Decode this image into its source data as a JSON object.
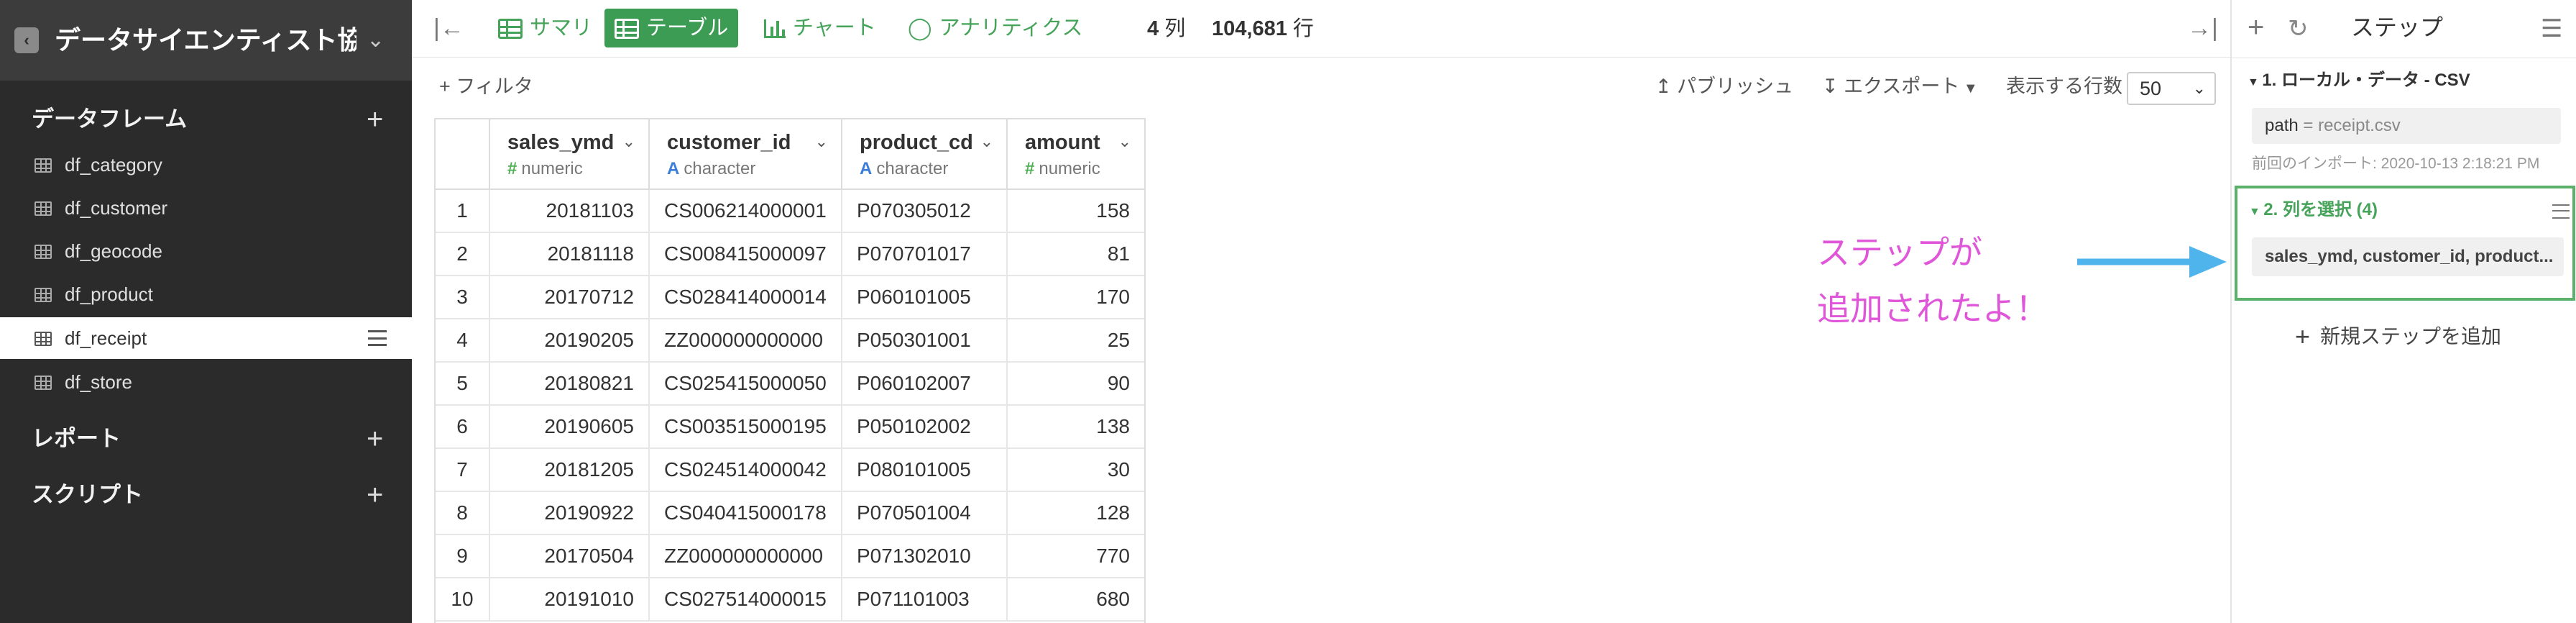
{
  "sidebar": {
    "title": "データサイエンティスト協...",
    "sections": {
      "dataframes": "データフレーム",
      "reports": "レポート",
      "scripts": "スクリプト"
    },
    "items": [
      {
        "label": "df_category"
      },
      {
        "label": "df_customer"
      },
      {
        "label": "df_geocode"
      },
      {
        "label": "df_product"
      },
      {
        "label": "df_receipt",
        "active": true
      },
      {
        "label": "df_store"
      }
    ]
  },
  "toolbar": {
    "tabs": [
      {
        "label": "サマリ",
        "icon": "summary-icon"
      },
      {
        "label": "テーブル",
        "icon": "table-icon",
        "active": true
      },
      {
        "label": "チャート",
        "icon": "chart-icon"
      },
      {
        "label": "アナリティクス",
        "icon": "analytics-icon"
      }
    ],
    "cols_count": "4",
    "cols_unit": "列",
    "rows_count": "104,681",
    "rows_unit": "行"
  },
  "actions": {
    "filter": "+ フィルタ",
    "publish": "パブリッシュ",
    "export": "エクスポート",
    "rows_label": "表示する行数",
    "rows_value": "50"
  },
  "table": {
    "columns": [
      {
        "name": "sales_ymd",
        "type": "numeric",
        "type_glyph": "#"
      },
      {
        "name": "customer_id",
        "type": "character",
        "type_glyph": "A"
      },
      {
        "name": "product_cd",
        "type": "character",
        "type_glyph": "A"
      },
      {
        "name": "amount",
        "type": "numeric",
        "type_glyph": "#"
      }
    ],
    "rows": [
      [
        "1",
        "20181103",
        "CS006214000001",
        "P070305012",
        "158"
      ],
      [
        "2",
        "20181118",
        "CS008415000097",
        "P070701017",
        "81"
      ],
      [
        "3",
        "20170712",
        "CS028414000014",
        "P060101005",
        "170"
      ],
      [
        "4",
        "20190205",
        "ZZ000000000000",
        "P050301001",
        "25"
      ],
      [
        "5",
        "20180821",
        "CS025415000050",
        "P060102007",
        "90"
      ],
      [
        "6",
        "20190605",
        "CS003515000195",
        "P050102002",
        "138"
      ],
      [
        "7",
        "20181205",
        "CS024514000042",
        "P080101005",
        "30"
      ],
      [
        "8",
        "20190922",
        "CS040415000178",
        "P070501004",
        "128"
      ],
      [
        "9",
        "20170504",
        "ZZ000000000000",
        "P071302010",
        "770"
      ],
      [
        "10",
        "20191010",
        "CS027514000015",
        "P071101003",
        "680"
      ]
    ]
  },
  "annotation": {
    "line1": "ステップが",
    "line2": "追加されたよ！",
    "color": "#e056d9",
    "arrow_color": "#4fb3ec"
  },
  "steps_panel": {
    "title": "ステップ",
    "step1": {
      "title": "1. ローカル・データ - CSV",
      "param_key": "path",
      "param_eq": " = ",
      "param_value": "receipt.csv",
      "note": "前回のインポート: 2020-10-13 2:18:21 PM"
    },
    "step2": {
      "title": "2. 列を選択 (4)",
      "content": "sales_ymd, customer_id, product..."
    },
    "add_step": "新規ステップを追加"
  },
  "colors": {
    "accent_green": "#3c9c53",
    "sidebar_bg": "#2b2b2b"
  }
}
